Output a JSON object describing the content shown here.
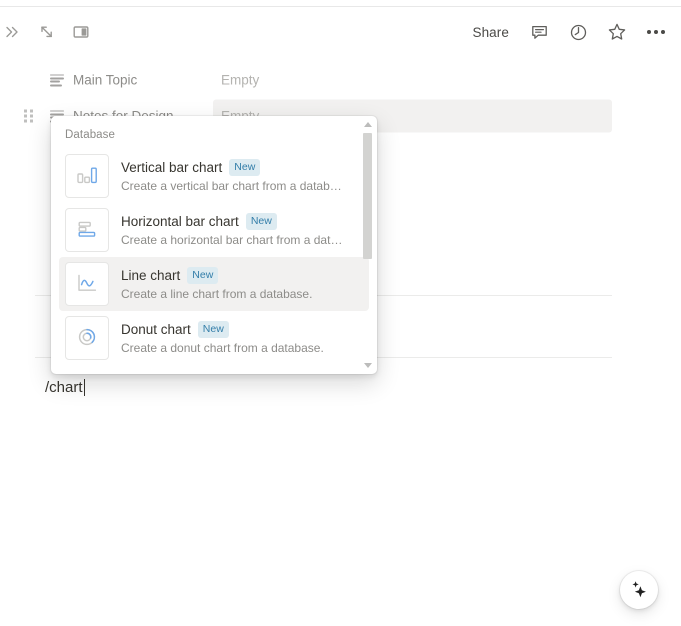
{
  "topbar": {
    "left_icons": [
      {
        "name": "expand-sidebar-icon",
        "glyph": "»"
      },
      {
        "name": "collapse-diagonal-icon",
        "glyph": "↘"
      },
      {
        "name": "side-peek-icon",
        "glyph": "▣"
      }
    ],
    "share_label": "Share",
    "right_icons": [
      {
        "name": "comment-icon"
      },
      {
        "name": "history-clock-icon"
      },
      {
        "name": "favorite-star-icon"
      },
      {
        "name": "more-options-icon"
      }
    ]
  },
  "properties": [
    {
      "icon": "text-property-icon",
      "name": "Main Topic",
      "value_placeholder": "Empty",
      "highlighted": false
    },
    {
      "icon": "text-property-icon",
      "name": "Notes for Design",
      "value_placeholder": "Empty",
      "highlighted": true
    }
  ],
  "editor": {
    "typed_command": "/chart"
  },
  "popup": {
    "section_label": "Database",
    "items": [
      {
        "icon": "vertical-bar-chart-icon",
        "title": "Vertical bar chart",
        "badge": "New",
        "description": "Create a vertical bar chart from a datab…",
        "active": false
      },
      {
        "icon": "horizontal-bar-chart-icon",
        "title": "Horizontal bar chart",
        "badge": "New",
        "description": "Create a horizontal bar chart from a dat…",
        "active": false
      },
      {
        "icon": "line-chart-icon",
        "title": "Line chart",
        "badge": "New",
        "description": "Create a line chart from a database.",
        "active": true
      },
      {
        "icon": "donut-chart-icon",
        "title": "Donut chart",
        "badge": "New",
        "description": "Create a donut chart from a database.",
        "active": false
      }
    ]
  },
  "fab": {
    "icon": "ai-sparkle-icon"
  },
  "colors": {
    "accent_blue": "#6fa8e8",
    "badge_text": "#337ea9",
    "badge_bg": "#ddebf1",
    "text_primary": "#37352f",
    "text_muted": "#8d8c89",
    "hover_bg": "#f2f1f0"
  }
}
